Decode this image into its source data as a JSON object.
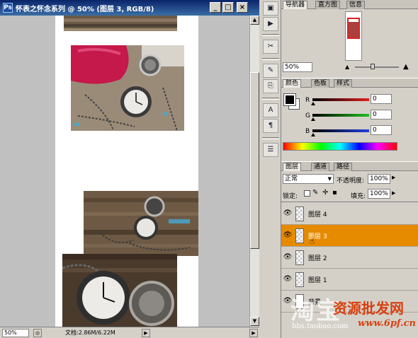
{
  "document": {
    "title": "怀表之怀念系列 @ 50% (图层 3, RGB/8)",
    "app_icon": "Ps",
    "buttons": {
      "minimize": "_",
      "maximize": "□",
      "close": "×"
    },
    "zoom": "50%",
    "doc_size": "文档:2.86M/6.22M"
  },
  "panels": {
    "navigator": {
      "tabs": [
        "导航器",
        "直方图",
        "信息"
      ],
      "zoom": "50%"
    },
    "color": {
      "tabs": [
        "颜色",
        "色板",
        "样式"
      ],
      "channels": [
        {
          "label": "R",
          "value": "0",
          "color": "#e03030"
        },
        {
          "label": "G",
          "value": "0",
          "color": "#20b020"
        },
        {
          "label": "B",
          "value": "0",
          "color": "#2040e0"
        }
      ],
      "foreground": "#000000",
      "background": "#ffffff"
    },
    "layers": {
      "tabs": [
        "图层",
        "通道",
        "路径"
      ],
      "blend_mode": "正常",
      "opacity_label": "不透明度:",
      "opacity": "100%",
      "lock_label": "锁定:",
      "fill_label": "填充:",
      "fill": "100%",
      "items": [
        {
          "name": "图层 4",
          "active": false
        },
        {
          "name": "图层 3",
          "active": true
        },
        {
          "name": "图层 2",
          "active": false
        },
        {
          "name": "图层 1",
          "active": false
        },
        {
          "name": "背景",
          "active": false
        }
      ]
    }
  },
  "watermarks": {
    "left_big": "淘宝",
    "right_big": "资源批发网",
    "site1": "bbs.taobao.com",
    "site2": "www.6pf.cn"
  }
}
